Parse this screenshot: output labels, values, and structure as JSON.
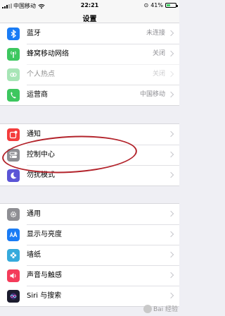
{
  "status_bar": {
    "carrier": "中国移动",
    "time": "22:21",
    "battery_text": "41%",
    "battery_level": 0.41
  },
  "nav": {
    "title": "设置"
  },
  "groups": [
    {
      "rows": [
        {
          "label": "蓝牙",
          "value": "未连接",
          "icon": "bluetooth-icon",
          "color": "#1a7cf5"
        },
        {
          "label": "蜂窝移动网络",
          "value": "关闭",
          "icon": "antenna-icon",
          "color": "#3dc75f"
        },
        {
          "label": "个人热点",
          "value": "关闭",
          "icon": "hotspot-icon",
          "color": "#3dc75f",
          "disabled": true
        },
        {
          "label": "运营商",
          "value": "中国移动",
          "icon": "phone-icon",
          "color": "#3dc75f"
        }
      ]
    },
    {
      "rows": [
        {
          "label": "通知",
          "icon": "notifications-icon",
          "color": "#f43c3c"
        },
        {
          "label": "控制中心",
          "icon": "control-center-icon",
          "color": "#8e8e93"
        },
        {
          "label": "勿扰模式",
          "icon": "moon-icon",
          "color": "#5b55d6"
        }
      ]
    },
    {
      "rows": [
        {
          "label": "通用",
          "icon": "gear-icon",
          "color": "#8e8e93"
        },
        {
          "label": "显示与亮度",
          "icon": "display-aa-icon",
          "color": "#1a7cf5"
        },
        {
          "label": "墙纸",
          "icon": "wallpaper-flower-icon",
          "color": "#35aadc"
        },
        {
          "label": "声音与触感",
          "icon": "speaker-icon",
          "color": "#f43c5a"
        },
        {
          "label": "Siri 与搜索",
          "icon": "siri-icon",
          "color": "#1c1c2e"
        }
      ]
    }
  ],
  "watermark": "Bai 经验"
}
